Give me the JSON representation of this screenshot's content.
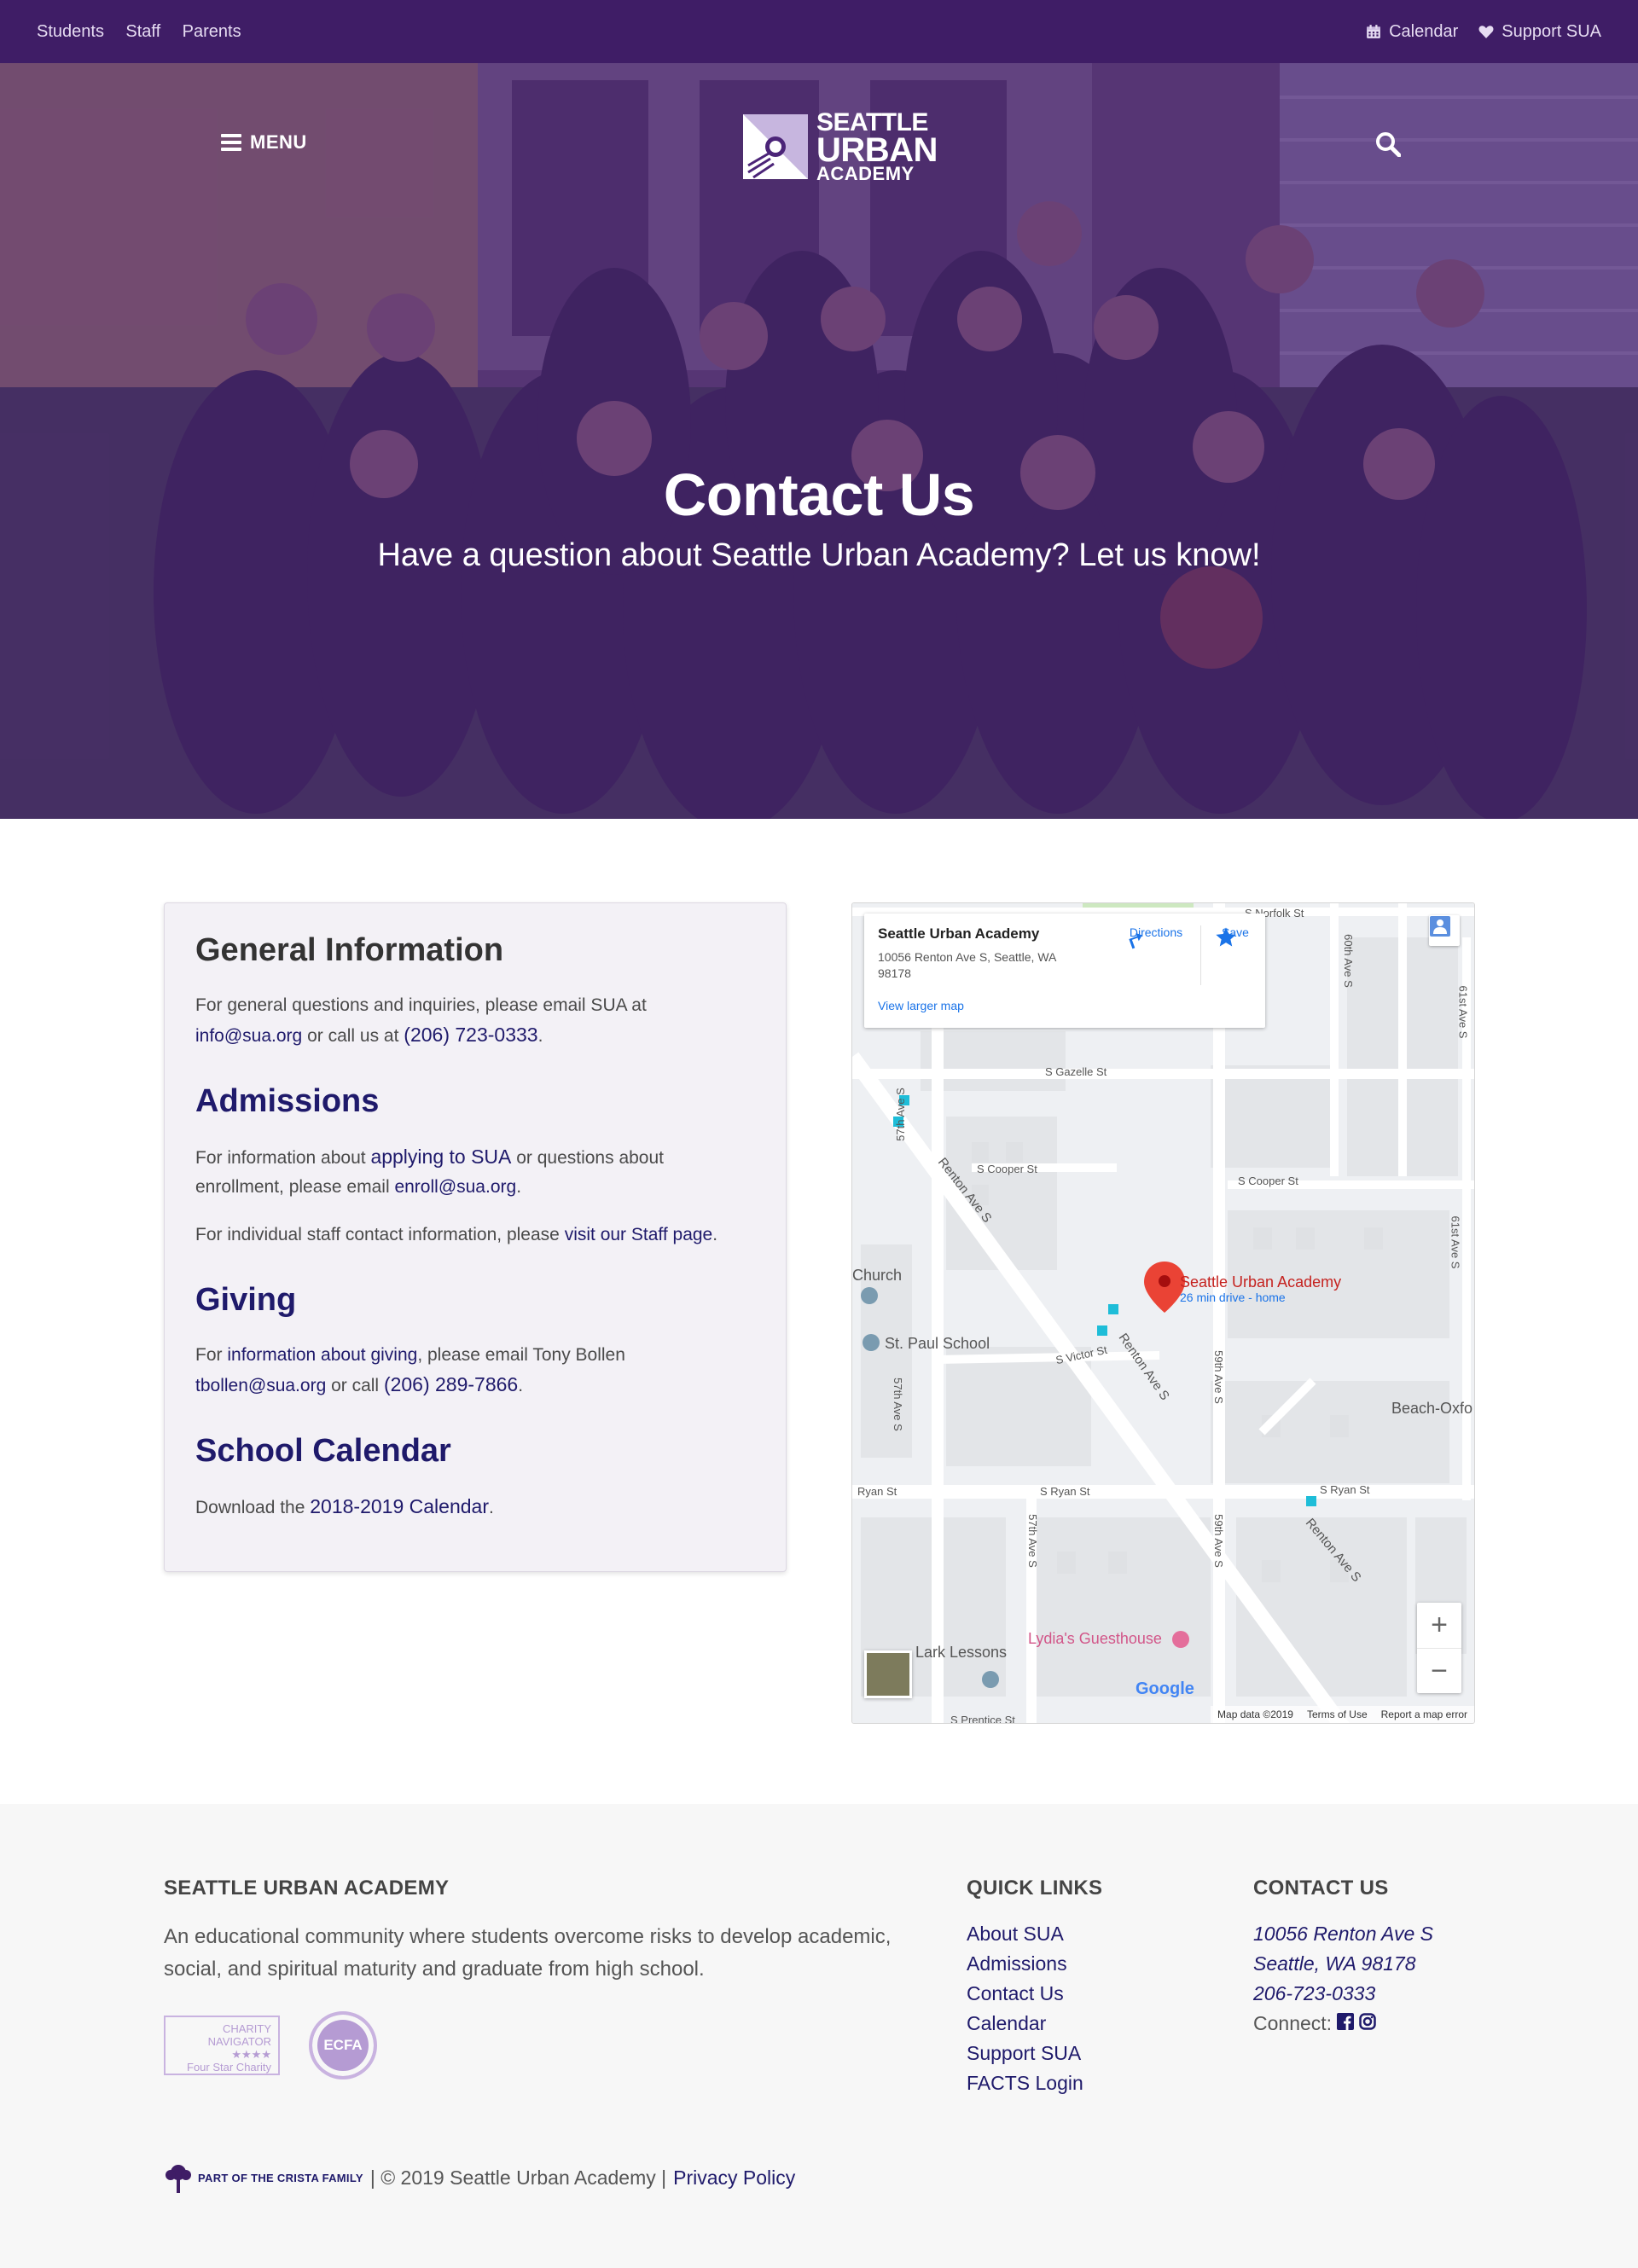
{
  "utility_nav": {
    "left": [
      "Students",
      "Staff",
      "Parents"
    ],
    "calendar": "Calendar",
    "support": "Support SUA"
  },
  "header": {
    "menu_label": "MENU",
    "logo": {
      "line1": "SEATTLE",
      "line2": "URBAN",
      "line3": "ACADEMY"
    }
  },
  "hero": {
    "title": "Contact Us",
    "subtitle": "Have a question about Seattle Urban Academy? Let us know!"
  },
  "general": {
    "heading": "General Information",
    "text_before_email": "For general questions and inquiries, please email SUA at ",
    "email": "info@sua.org",
    "text_after_email": " or call us at ",
    "phone": "(206) 723-0333",
    "end": "."
  },
  "admissions": {
    "heading": "Admissions",
    "p1_before": "For information about ",
    "p1_link": "applying to SUA",
    "p1_middle": " or questions about enrollment, please email ",
    "p1_email": "enroll@sua.org",
    "p1_end": ".",
    "p2_before": "For individual staff contact information, please ",
    "p2_link": "visit our Staff page",
    "p2_end": "."
  },
  "giving": {
    "heading": "Giving",
    "before": "For ",
    "link": "information about giving",
    "middle": ", please email Tony Bollen ",
    "email": "tbollen@sua.org",
    "after": " or call ",
    "phone": "(206) 289-7866",
    "end": "."
  },
  "calendar_section": {
    "heading": "School Calendar",
    "before": "Download the ",
    "link": "2018-2019 Calendar",
    "end": "."
  },
  "map": {
    "popup_title": "Seattle Urban Academy",
    "popup_address": "10056 Renton Ave S, Seattle, WA 98178",
    "directions": "Directions",
    "save": "Save",
    "view_larger": "View larger map",
    "pin_label": "Seattle Urban Academy",
    "pin_sub": "26 min drive - home",
    "streets": {
      "norfolk": "S Norfolk St",
      "ave60": "60th Ave S",
      "ave61a": "61st Ave S",
      "gazelle": "S Gazelle St",
      "ave57a": "57th Ave S",
      "cooper_a": "S Cooper St",
      "cooper_b": "S Cooper St",
      "renton_a": "Renton Ave S",
      "ave61b": "61st Ave S",
      "victor": "S Victor St",
      "renton_b": "Renton Ave S",
      "ave59a": "59th Ave S",
      "ave57b": "57th Ave S",
      "ryan_a": "Ryan St",
      "ryan_b": "S Ryan St",
      "ryan_c": "S Ryan St",
      "ave57c": "57th Ave S",
      "ave59b": "59th Ave S",
      "renton_c": "Renton Ave S",
      "prentice": "S Prentice St"
    },
    "places": {
      "church": "Church",
      "st_paul": "St. Paul School",
      "beach": "Beach-Oxfo",
      "lydias": "Lydia's Guesthouse",
      "lark": "Lark Lessons"
    },
    "google": "Google",
    "map_data": "Map data ©2019",
    "terms": "Terms of Use",
    "report": "Report a map error",
    "zoom_in": "+",
    "zoom_out": "−"
  },
  "footer": {
    "about_heading": "SEATTLE URBAN ACADEMY",
    "about_text": "An educational community where students overcome risks to develop academic, social, and spiritual maturity and graduate from high school.",
    "badge_charity": {
      "line1": "CHARITY",
      "line2": "NAVIGATOR",
      "stars": "★★★★",
      "line3": "Four Star Charity"
    },
    "badge_ecfa": "ECFA",
    "links_heading": "QUICK LINKS",
    "links": [
      "About SUA",
      "Admissions",
      "Contact Us",
      "Calendar",
      "Support SUA",
      "FACTS Login"
    ],
    "contact_heading": "CONTACT US",
    "address1": "10056 Renton Ave S",
    "address2": "Seattle, WA 98178",
    "phone": "206-723-0333",
    "connect": "Connect:",
    "crista": "PART OF THE CRISTA FAMILY",
    "copyright": "| © 2019 Seattle Urban Academy |",
    "privacy": "Privacy Policy"
  }
}
